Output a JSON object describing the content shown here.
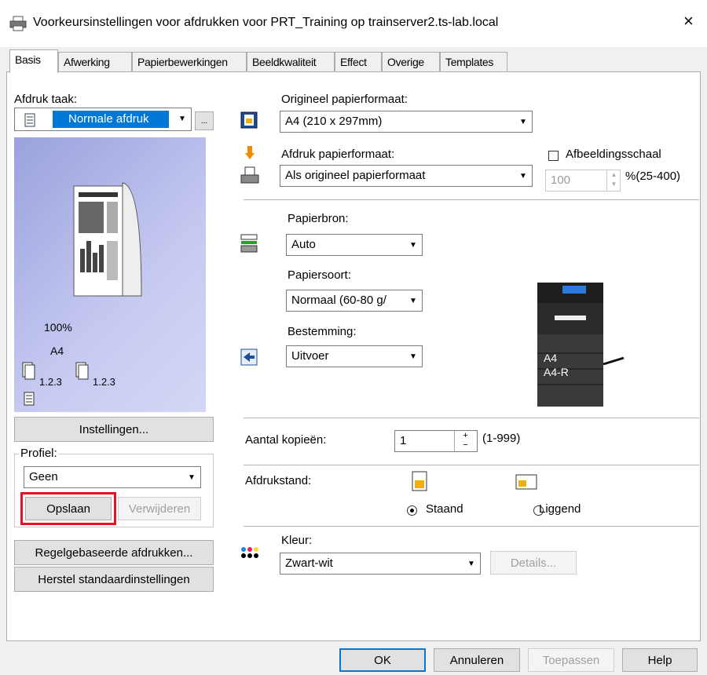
{
  "window": {
    "title": "Voorkeursinstellingen voor afdrukken voor PRT_Training op trainserver2.ts-lab.local",
    "close": "×"
  },
  "tabs": [
    "Basis",
    "Afwerking",
    "Papierbewerkingen",
    "Beeldkwaliteit",
    "Effect",
    "Overige",
    "Templates"
  ],
  "left": {
    "job_label": "Afdruk taak:",
    "job_value": "Normale afdruk",
    "job_more": "...",
    "preview": {
      "scale": "100%",
      "paper": "A4",
      "collate_a": "1.2.3",
      "collate_b": "1.2.3"
    },
    "settings_button": "Instellingen...",
    "profile_label": "Profiel:",
    "profile_value": "Geen",
    "save_button": "Opslaan",
    "delete_button": "Verwijderen",
    "rule_button": "Regelgebaseerde afdrukken...",
    "restore_button": "Herstel standaardinstellingen"
  },
  "right": {
    "orig_label": "Origineel papierformaat:",
    "orig_value": "A4 (210 x 297mm)",
    "print_label": "Afdruk papierformaat:",
    "print_value": "Als origineel papierformaat",
    "scale_checkbox": "Afbeeldingsschaal",
    "scale_value": "100",
    "scale_range": "%(25-400)",
    "source_label": "Papierbron:",
    "source_value": "Auto",
    "type_label": "Papiersoort:",
    "type_value": "Normaal (60-80 g/",
    "dest_label": "Bestemming:",
    "dest_value": "Uitvoer",
    "printer_tray1": "A4",
    "printer_tray2": "A4-R",
    "copies_label": "Aantal kopieën:",
    "copies_value": "1",
    "copies_range": "(1-999)",
    "orientation_label": "Afdrukstand:",
    "portrait": "Staand",
    "landscape": "Liggend",
    "color_label": "Kleur:",
    "color_value": "Zwart-wit",
    "details_button": "Details..."
  },
  "footer": {
    "ok": "OK",
    "cancel": "Annuleren",
    "apply": "Toepassen",
    "help": "Help"
  },
  "colors": {
    "highlight": "#0078d7",
    "save_border": "#e81123",
    "preview_bg": "#a9aee3"
  }
}
